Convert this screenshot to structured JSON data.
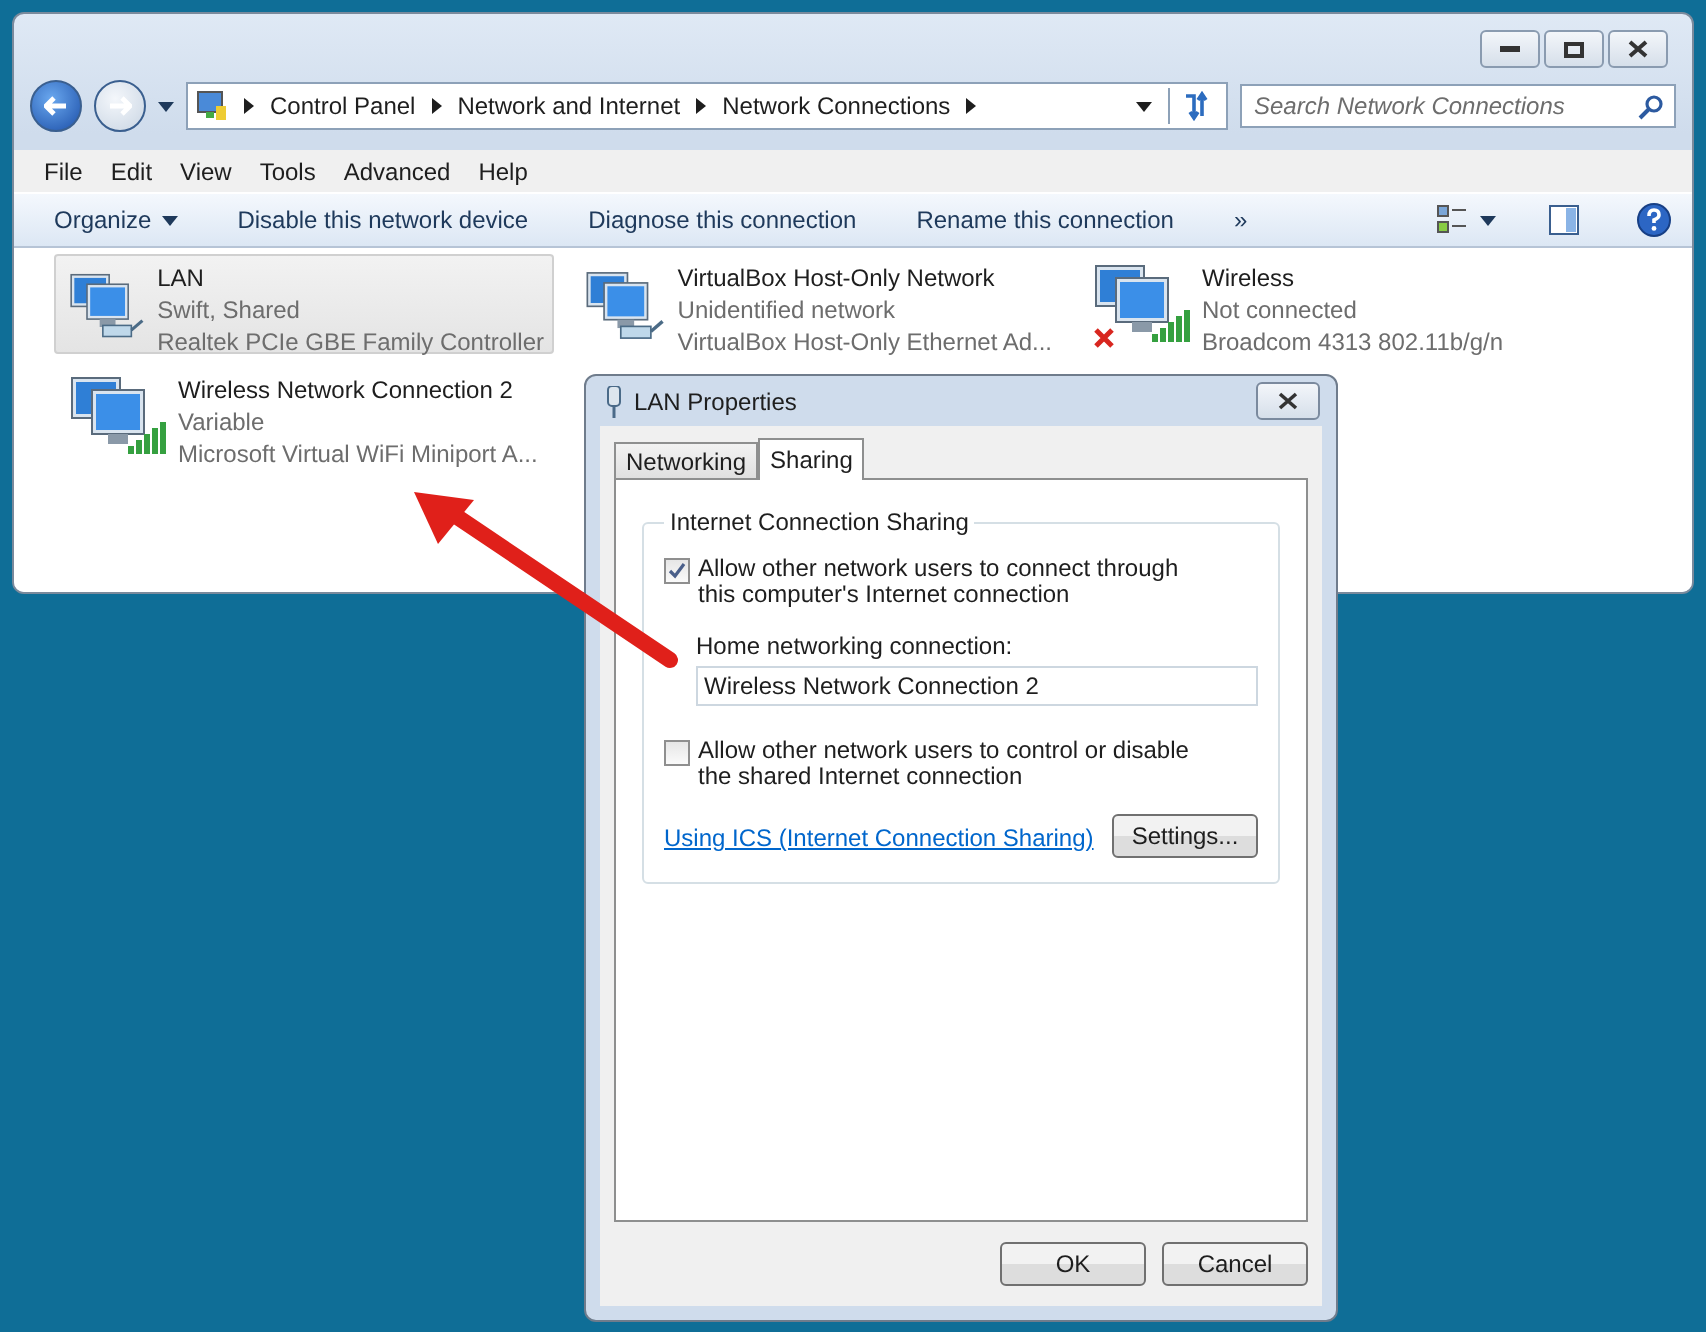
{
  "explorer": {
    "breadcrumbs": [
      "Control Panel",
      "Network and Internet",
      "Network Connections"
    ],
    "search": {
      "placeholder": "Search Network Connections"
    },
    "menu": [
      "File",
      "Edit",
      "View",
      "Tools",
      "Advanced",
      "Help"
    ],
    "commands": [
      {
        "label": "Organize",
        "dropdown": true
      },
      {
        "label": "Disable this network device",
        "dropdown": false
      },
      {
        "label": "Diagnose this connection",
        "dropdown": false
      },
      {
        "label": "Rename this connection",
        "dropdown": false
      }
    ],
    "more": "»",
    "connections": [
      {
        "name": "LAN",
        "status": "Swift, Shared",
        "device": "Realtek PCIe GBE Family Controller",
        "kind": "wired",
        "disconnected": false,
        "selected": true
      },
      {
        "name": "VirtualBox Host-Only Network",
        "status": "Unidentified network",
        "device": "VirtualBox Host-Only Ethernet Ad...",
        "kind": "wired",
        "disconnected": false,
        "selected": false
      },
      {
        "name": "Wireless",
        "status": "Not connected",
        "device": "Broadcom 4313 802.11b/g/n",
        "kind": "wireless",
        "disconnected": true,
        "selected": false
      },
      {
        "name": "Wireless Network Connection 2",
        "status": "Variable",
        "device": "Microsoft Virtual WiFi Miniport A...",
        "kind": "wireless",
        "disconnected": false,
        "selected": false
      }
    ]
  },
  "dialog": {
    "title": "LAN Properties",
    "tabs": [
      {
        "label": "Networking",
        "selected": false
      },
      {
        "label": "Sharing",
        "selected": true
      }
    ],
    "group_title": "Internet Connection Sharing",
    "allow_connect": {
      "label": "Allow other network users to connect through this computer's Internet connection",
      "checked": true
    },
    "home_label": "Home networking connection:",
    "home_value": "Wireless Network Connection 2",
    "allow_control": {
      "label": "Allow other network users to control or disable the shared Internet connection",
      "checked": false
    },
    "link": "Using ICS (Internet Connection Sharing)",
    "settings_button": "Settings...",
    "buttons": [
      "OK",
      "Cancel"
    ]
  }
}
